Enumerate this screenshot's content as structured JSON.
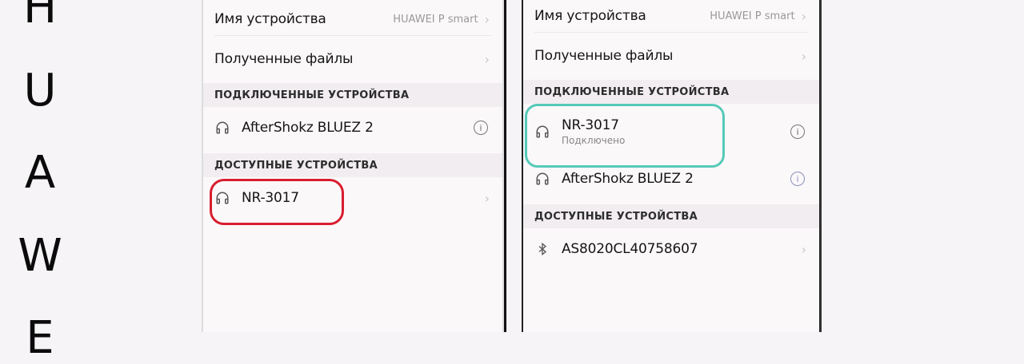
{
  "brand": {
    "letters": [
      "H",
      "U",
      "A",
      "W",
      "E"
    ]
  },
  "left_screen": {
    "device_name_label": "Имя устройства",
    "device_name_value": "HUAWEI P smart",
    "received_files_label": "Полученные файлы",
    "connected_header": "ПОДКЛЮЧЕННЫЕ УСТРОЙСТВА",
    "connected_devices": [
      {
        "name": "AfterShokz BLUEZ 2"
      }
    ],
    "available_header": "ДОСТУПНЫЕ УСТРОЙСТВА",
    "available_devices": [
      {
        "name": "NR-3017"
      }
    ]
  },
  "right_screen": {
    "device_name_label": "Имя устройства",
    "device_name_value": "HUAWEI P smart",
    "received_files_label": "Полученные файлы",
    "connected_header": "ПОДКЛЮЧЕННЫЕ УСТРОЙСТВА",
    "connected_devices": [
      {
        "name": "NR-3017",
        "status": "Подключено"
      },
      {
        "name": "AfterShokz BLUEZ 2"
      }
    ],
    "available_header": "ДОСТУПНЫЕ УСТРОЙСТВА",
    "available_devices": [
      {
        "name": "AS8020CL40758607"
      }
    ]
  },
  "colors": {
    "highlight_red": "#d81d2e",
    "highlight_teal": "#56c9b8"
  },
  "icons": {
    "headphones": "headphones-icon",
    "bluetooth": "bluetooth-icon",
    "info": "info-icon",
    "chevron": "chevron-right-icon"
  }
}
